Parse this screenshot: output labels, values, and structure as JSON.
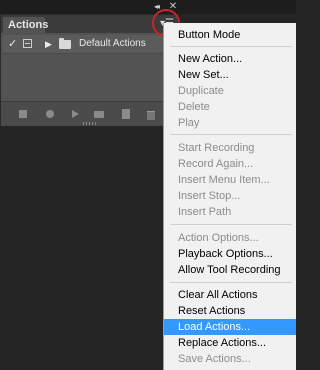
{
  "window": {
    "collapse_glyph": "◂◂",
    "close_glyph": "✕"
  },
  "panel": {
    "tab_label": "Actions",
    "menu_glyph": "▾☰",
    "row": {
      "check": "✓",
      "expand": "▶",
      "set_name": "Default Actions"
    }
  },
  "menu": {
    "items": [
      {
        "label": "Button Mode",
        "state": "normal"
      },
      {
        "label": "New Action...",
        "state": "normal"
      },
      {
        "label": "New Set...",
        "state": "normal"
      },
      {
        "label": "Duplicate",
        "state": "disabled"
      },
      {
        "label": "Delete",
        "state": "disabled"
      },
      {
        "label": "Play",
        "state": "disabled"
      },
      {
        "label": "Start Recording",
        "state": "disabled"
      },
      {
        "label": "Record Again...",
        "state": "disabled"
      },
      {
        "label": "Insert Menu Item...",
        "state": "disabled"
      },
      {
        "label": "Insert Stop...",
        "state": "disabled"
      },
      {
        "label": "Insert Path",
        "state": "disabled"
      },
      {
        "label": "Action Options...",
        "state": "disabled"
      },
      {
        "label": "Playback Options...",
        "state": "normal"
      },
      {
        "label": "Allow Tool Recording",
        "state": "normal"
      },
      {
        "label": "Clear All Actions",
        "state": "normal"
      },
      {
        "label": "Reset Actions",
        "state": "normal"
      },
      {
        "label": "Load Actions...",
        "state": "selected"
      },
      {
        "label": "Replace Actions...",
        "state": "normal"
      },
      {
        "label": "Save Actions...",
        "state": "disabled"
      }
    ]
  },
  "colors": {
    "selection": "#3399ff",
    "annotation_circle": "#c8242b"
  }
}
